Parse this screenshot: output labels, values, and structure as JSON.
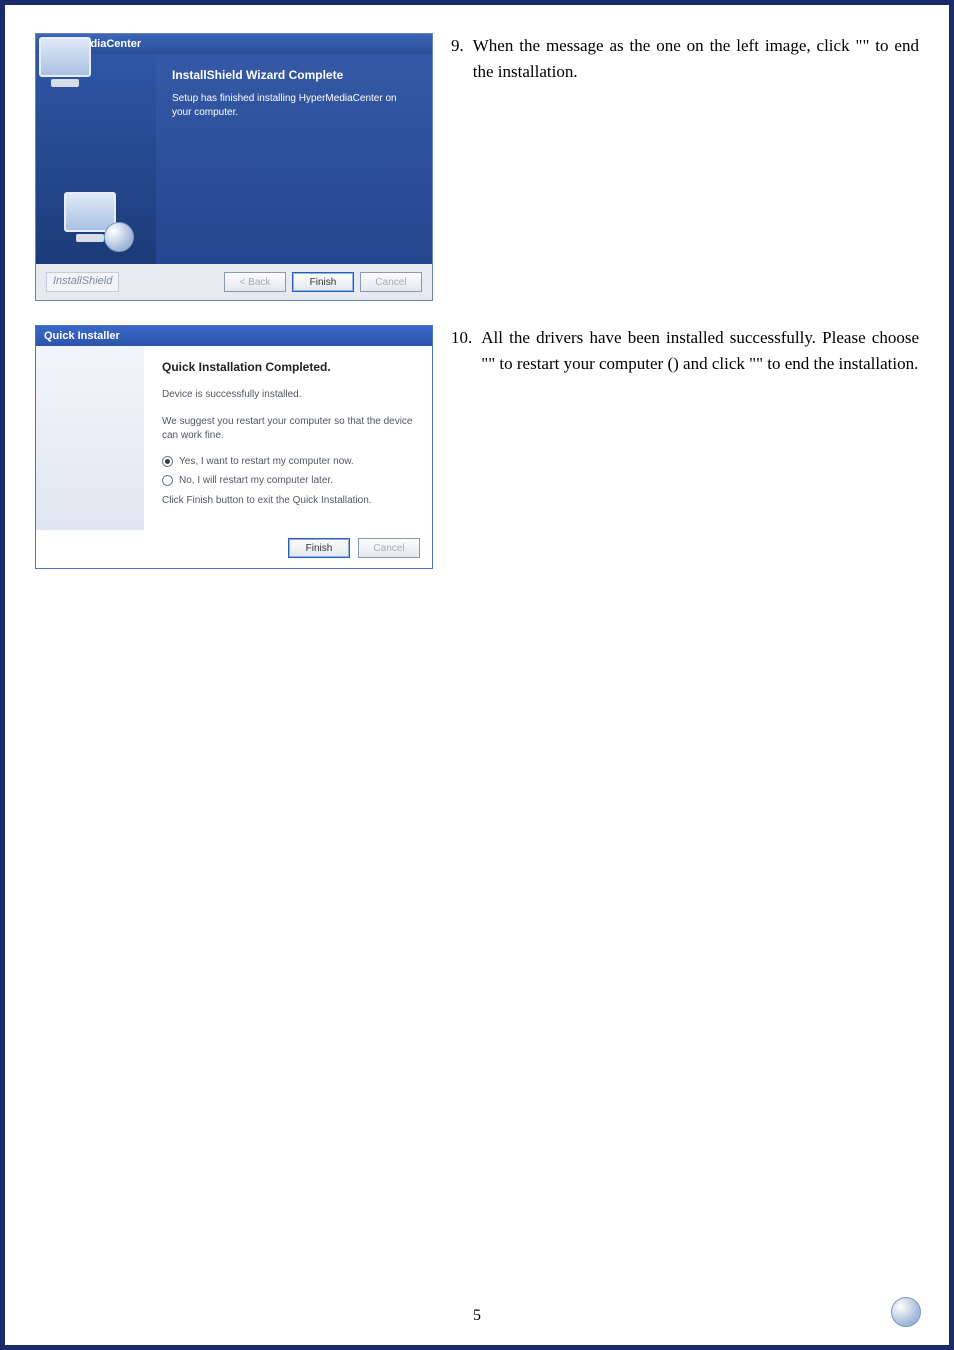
{
  "step9": {
    "num": "9.",
    "text_a": "When the message as the one on the left image, click \"",
    "blank1": "",
    "text_b": "\" to end the installation."
  },
  "step10": {
    "num": "10.",
    "text_a": "All the drivers have been installed successfully. Please choose \"",
    "blank1": "",
    "text_b": "\" to restart your computer (",
    "blank2": "",
    "text_c": ") and click \"",
    "blank3": "",
    "text_d": "\" to end the installation."
  },
  "installer": {
    "title": "HyperMediaCenter",
    "heading": "InstallShield Wizard Complete",
    "subtext": "Setup has finished installing HyperMediaCenter on your computer.",
    "badge": "InstallShield",
    "back": "< Back",
    "finish": "Finish",
    "cancel": "Cancel"
  },
  "quick": {
    "title": "Quick Installer",
    "heading": "Quick Installation Completed.",
    "line1": "Device is successfully installed.",
    "line2": "We suggest you restart your computer so that the device can work fine.",
    "opt_yes": "Yes, I want to restart my computer now.",
    "opt_no": "No, I will restart my computer later.",
    "line3": "Click Finish button to exit the Quick Installation.",
    "finish": "Finish",
    "cancel": "Cancel"
  },
  "pagenum": "5"
}
